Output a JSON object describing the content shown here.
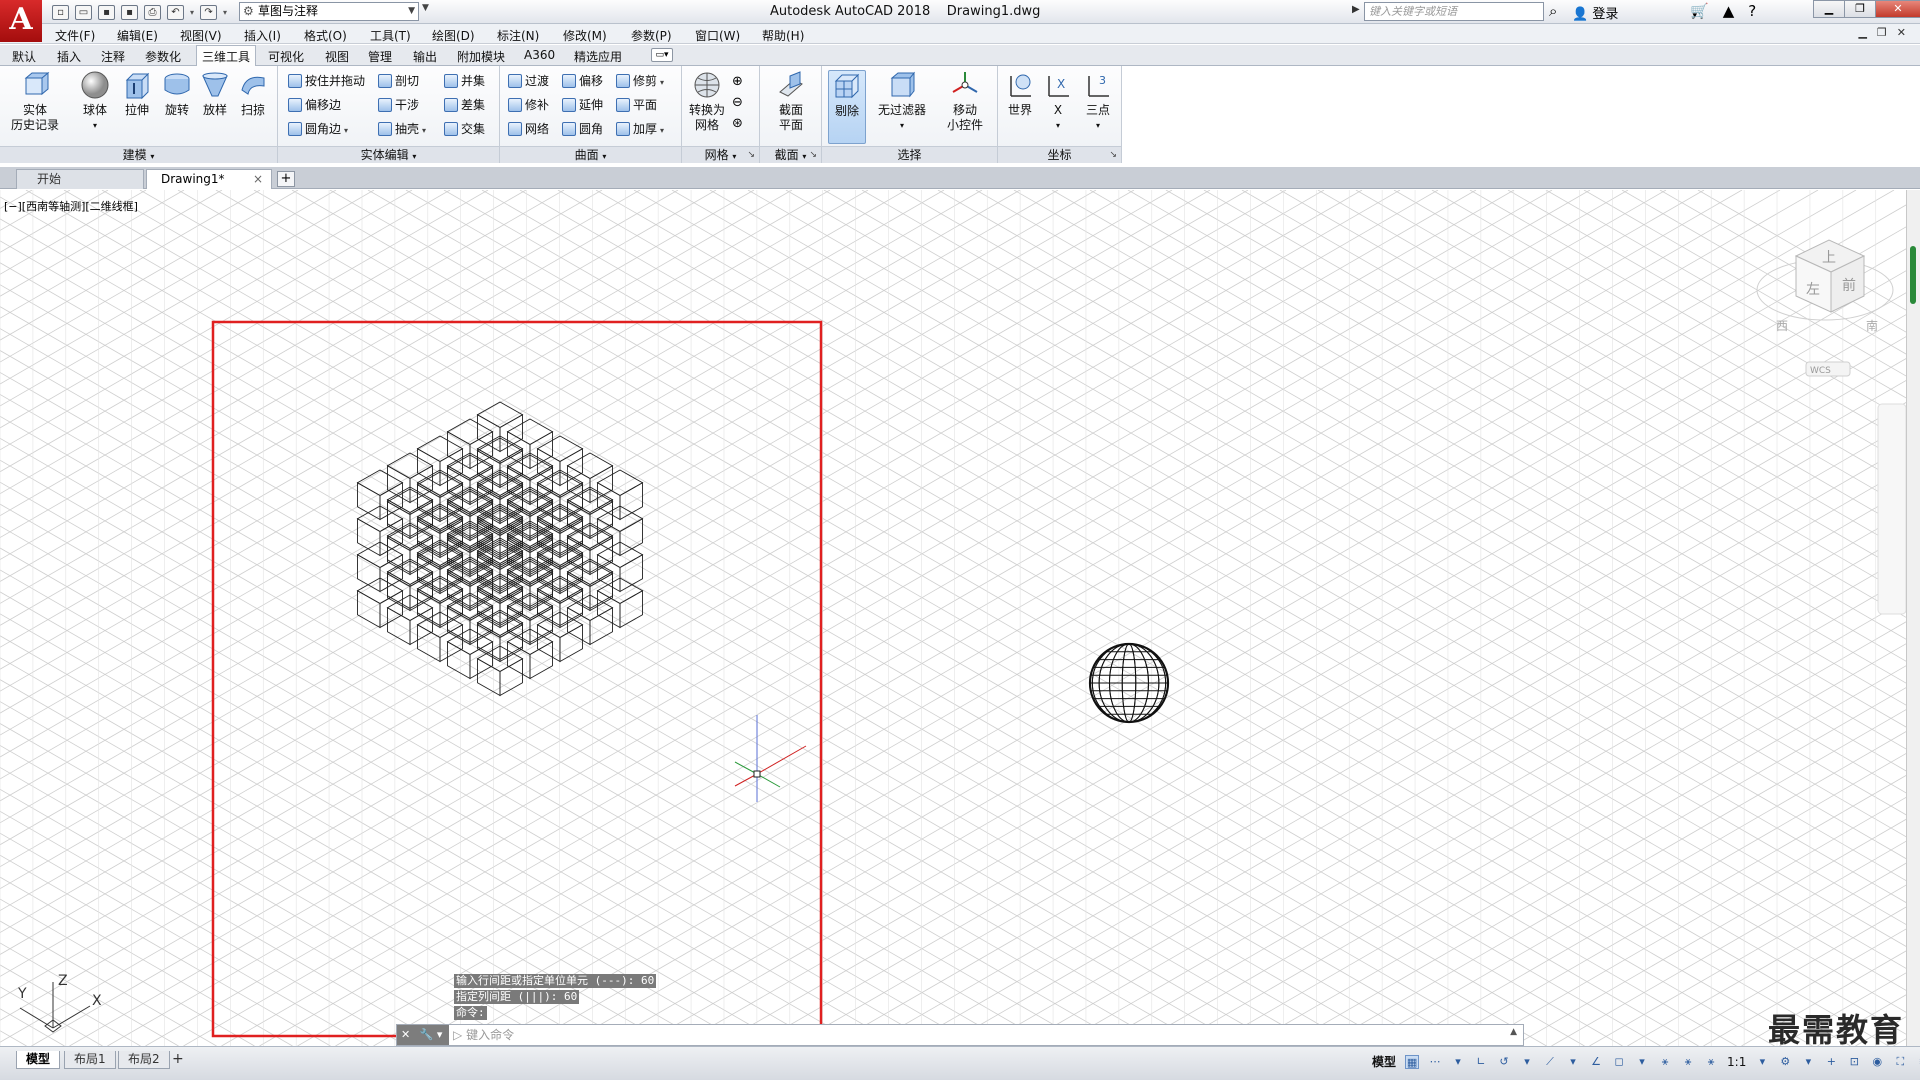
{
  "app": {
    "logo": "A",
    "title": "Autodesk AutoCAD 2018    Drawing1.dwg",
    "workspace": "草图与注释",
    "search_placeholder": "键入关键字或短语",
    "login": "登录"
  },
  "menu": [
    "文件(F)",
    "编辑(E)",
    "视图(V)",
    "插入(I)",
    "格式(O)",
    "工具(T)",
    "绘图(D)",
    "标注(N)",
    "修改(M)",
    "参数(P)",
    "窗口(W)",
    "帮助(H)"
  ],
  "ribbon_tabs": [
    "默认",
    "插入",
    "注释",
    "参数化",
    "三维工具",
    "可视化",
    "视图",
    "管理",
    "输出",
    "附加模块",
    "A360",
    "精选应用"
  ],
  "ribbon_active_tab": "三维工具",
  "panels": {
    "modeling": {
      "title": "建模",
      "buttons": [
        {
          "label": "实体\n历史记录"
        },
        {
          "label": "球体"
        },
        {
          "label": "拉伸"
        },
        {
          "label": "旋转"
        },
        {
          "label": "放样"
        },
        {
          "label": "扫掠"
        }
      ]
    },
    "solid_edit": {
      "title": "实体编辑",
      "buttons": [
        "按住并拖动",
        "偏移边",
        "圆角边",
        "剖切",
        "干涉",
        "抽壳",
        "并集",
        "差集",
        "交集"
      ]
    },
    "surface": {
      "title": "曲面",
      "buttons": [
        "过渡",
        "修补",
        "网络",
        "偏移",
        "延伸",
        "圆角",
        "修剪",
        "平面",
        "加厚"
      ]
    },
    "mesh": {
      "title": "网格",
      "button": "转换为\n网格"
    },
    "section": {
      "title": "截面",
      "button": "截面\n平面"
    },
    "selection": {
      "title": "选择",
      "buttons": [
        "剔除",
        "无过滤器",
        "移动\n小控件"
      ]
    },
    "coordinates": {
      "title": "坐标",
      "buttons": [
        "世界",
        "X",
        "三点"
      ]
    }
  },
  "file_tabs": [
    {
      "label": "开始"
    },
    {
      "label": "Drawing1*"
    }
  ],
  "viewport_label": "[−][西南等轴测][二维线框]",
  "viewcube": {
    "top": "上",
    "left": "左",
    "front": "前",
    "south": "南",
    "west": "西",
    "wcs": "WCS"
  },
  "ucs_labels": {
    "x": "X",
    "y": "Y",
    "z": "Z"
  },
  "command_history": [
    "输入行间距或指定单位单元 (---): 60",
    "指定列间距 (|||): 60",
    "命令:"
  ],
  "command_placeholder": "键入命令",
  "layout_tabs": [
    "模型",
    "布局1",
    "布局2"
  ],
  "status": {
    "model": "模型",
    "scale": "1:1"
  },
  "watermark": "最需教育",
  "colors": {
    "accent_red": "#e02020",
    "selection_blue": "#b6d3f3",
    "grid_line": "#c8c8c8"
  }
}
